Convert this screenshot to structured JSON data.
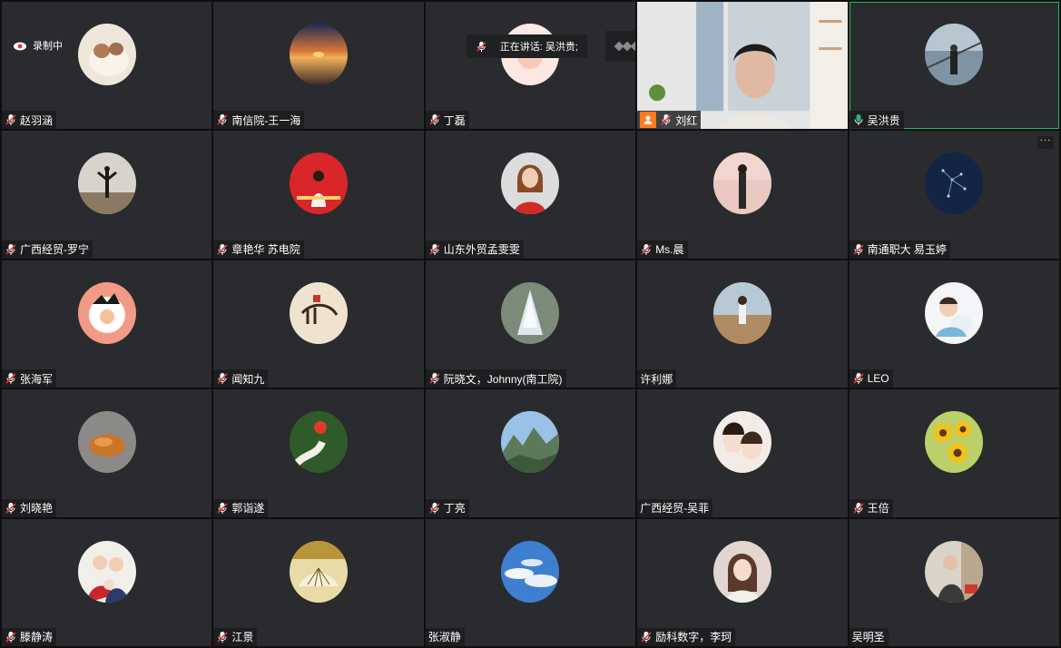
{
  "meeting": {
    "recording_label": "录制中",
    "speaking_label": "正在讲话: 吴洪贵;"
  },
  "participants": [
    {
      "name": "赵羽涵",
      "mic": "muted"
    },
    {
      "name": "南信院-王一海",
      "mic": "muted"
    },
    {
      "name": "丁磊",
      "mic": "muted"
    },
    {
      "name": "刘红",
      "mic": "muted",
      "video": true,
      "host": true
    },
    {
      "name": "吴洪贵",
      "mic": "speaking",
      "active": true
    },
    {
      "name": "广西经贸-罗宁",
      "mic": "muted"
    },
    {
      "name": "章艳华 苏电院",
      "mic": "muted"
    },
    {
      "name": "山东外贸孟雯雯",
      "mic": "muted"
    },
    {
      "name": "Ms.晨",
      "mic": "muted"
    },
    {
      "name": "南通职大 易玉婷",
      "mic": "muted",
      "menu": true
    },
    {
      "name": "张海军",
      "mic": "muted"
    },
    {
      "name": "闻知九",
      "mic": "muted"
    },
    {
      "name": "阮晓文，Johnny(南工院)",
      "mic": "muted"
    },
    {
      "name": "许利娜",
      "mic": "none"
    },
    {
      "name": "LEO",
      "mic": "muted"
    },
    {
      "name": "刘晓艳",
      "mic": "muted"
    },
    {
      "name": "郭诣遂",
      "mic": "muted"
    },
    {
      "name": "丁亮",
      "mic": "muted"
    },
    {
      "name": "广西经贸-吴菲",
      "mic": "none"
    },
    {
      "name": "王倍",
      "mic": "muted"
    },
    {
      "name": "滕静涛",
      "mic": "muted"
    },
    {
      "name": "江景",
      "mic": "muted"
    },
    {
      "name": "张淑静",
      "mic": "none"
    },
    {
      "name": "励科数字，李珂",
      "mic": "muted"
    },
    {
      "name": "吴明圣",
      "mic": "none"
    }
  ],
  "colors": {
    "accent": "#1fbf6a",
    "muted_red": "#e0363a",
    "tile_bg": "#2a2b2e",
    "host_orange": "#ff7a1a"
  },
  "icons": {
    "more": "···"
  }
}
